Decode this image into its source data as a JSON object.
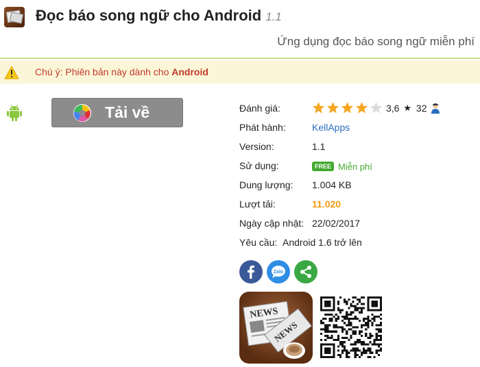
{
  "header": {
    "title": "Đọc báo song ngữ cho Android",
    "version": "1.1",
    "subtitle": "Ứng dụng đọc báo song ngữ miễn phí",
    "icon": "news-app-icon"
  },
  "notice": {
    "prefix": "Chú ý: Phiên bản này dành cho",
    "platform": "Android",
    "icon": "warning-icon",
    "color": "#c0392b"
  },
  "download": {
    "label": "Tải về",
    "icon": "download-logo-icon",
    "platform_icon": "android-icon"
  },
  "info": {
    "rating": {
      "label": "Đánh giá:",
      "stars": 4,
      "max_stars": 5,
      "score": "3,6",
      "count_prefix": "★",
      "count": "32",
      "icon": "user-icon"
    },
    "publisher": {
      "label": "Phát hành:",
      "value": "KellApps"
    },
    "version": {
      "label": "Version:",
      "value": "1.1"
    },
    "license": {
      "label": "Sử dụng:",
      "badge": "FREE",
      "value": "Miễn phí"
    },
    "size": {
      "label": "Dung lượng:",
      "value": "1.004 KB"
    },
    "downloads": {
      "label": "Lượt tải:",
      "value": "11.020"
    },
    "updated": {
      "label": "Ngày cập nhật:",
      "value": "22/02/2017"
    },
    "requirement": {
      "label": "Yêu cầu:",
      "value": "Android 1.6 trở lên"
    }
  },
  "share": [
    {
      "name": "facebook",
      "icon": "facebook-icon",
      "color": "#3b5998",
      "glyph": "f"
    },
    {
      "name": "zalo",
      "icon": "zalo-icon",
      "color": "#2f8de4",
      "glyph": "Zalo"
    },
    {
      "name": "share",
      "icon": "share-icon",
      "color": "#3aa845"
    }
  ],
  "images": {
    "app_icon": {
      "icon": "news-app-icon",
      "text_top": "NEWS",
      "text_bottom": "NEWS"
    },
    "qr": {
      "icon": "qr-code-icon"
    }
  },
  "colors": {
    "accent_line": "#c7e28a",
    "notice_bg": "#fbf6d8",
    "link": "#2a6ebf",
    "downloads": "#f39c12",
    "free": "#43a82f",
    "star": "#f5a623"
  }
}
